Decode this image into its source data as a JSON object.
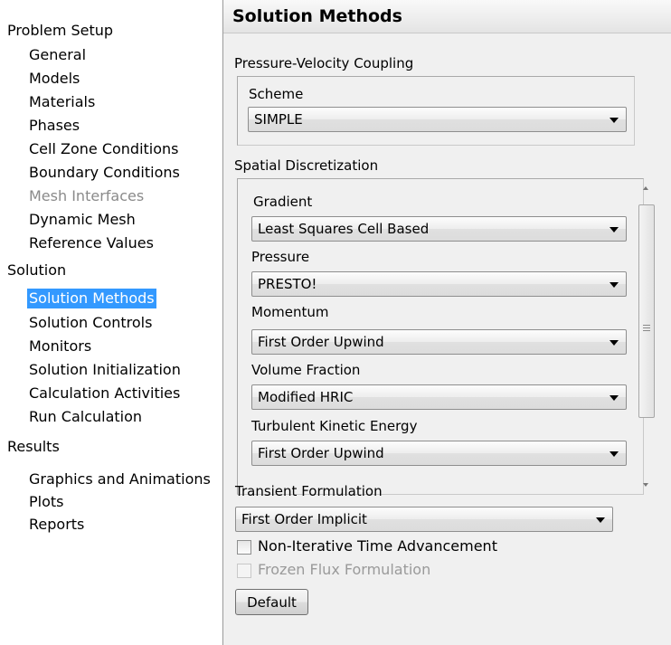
{
  "tree": {
    "problem_setup": {
      "label": "Problem Setup",
      "items": [
        "General",
        "Models",
        "Materials",
        "Phases",
        "Cell Zone Conditions",
        "Boundary Conditions",
        "Mesh Interfaces",
        "Dynamic Mesh",
        "Reference Values"
      ]
    },
    "solution": {
      "label": "Solution",
      "items": [
        "Solution Methods",
        "Solution Controls",
        "Monitors",
        "Solution Initialization",
        "Calculation Activities",
        "Run Calculation"
      ]
    },
    "results": {
      "label": "Results",
      "items": [
        "Graphics and Animations",
        "Plots",
        "Reports"
      ]
    },
    "selected_item": "Solution Methods",
    "disabled_item": "Mesh Interfaces"
  },
  "panel": {
    "title": "Solution Methods",
    "pv_coupling": {
      "group_label": "Pressure-Velocity Coupling",
      "scheme_label": "Scheme",
      "scheme_value": "SIMPLE"
    },
    "spatial": {
      "group_label": "Spatial Discretization",
      "fields": [
        {
          "label": "Gradient",
          "value": "Least Squares Cell Based"
        },
        {
          "label": "Pressure",
          "value": "PRESTO!"
        },
        {
          "label": "Momentum",
          "value": "First Order Upwind"
        },
        {
          "label": "Volume Fraction",
          "value": "Modified HRIC"
        },
        {
          "label": "Turbulent Kinetic Energy",
          "value": "First Order Upwind"
        }
      ]
    },
    "transient": {
      "label": "Transient Formulation",
      "value": "First Order Implicit"
    },
    "options": [
      {
        "label": "Non-Iterative Time Advancement",
        "checked": false,
        "enabled": true
      },
      {
        "label": "Frozen Flux Formulation",
        "checked": false,
        "enabled": false
      }
    ],
    "default_button_label": "Default"
  },
  "colors": {
    "selection": "#3399ff",
    "disabled_text": "#8a8a8a",
    "panel_background": "#f0f0f0"
  },
  "icons": {
    "combo_arrow": "chevron-down-icon",
    "scroll_up": "scroll-up-arrow-icon",
    "scroll_down": "scroll-down-arrow-icon"
  }
}
